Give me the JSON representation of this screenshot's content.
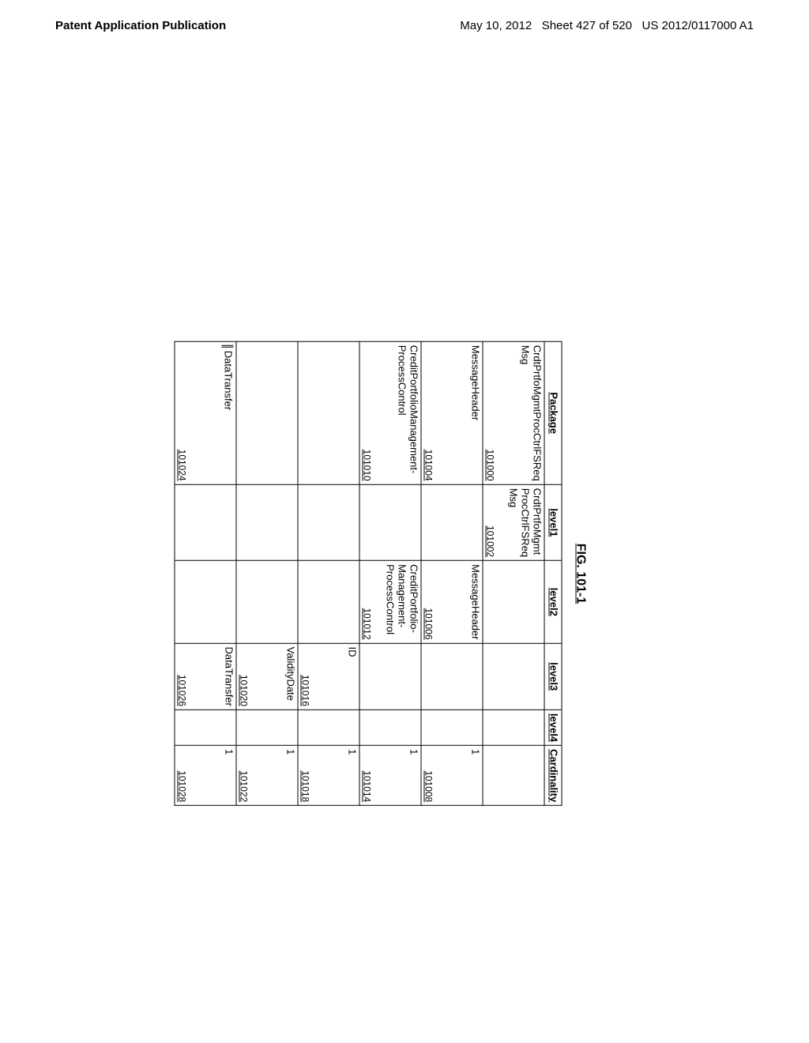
{
  "header": {
    "left": "Patent Application Publication",
    "right_date": "May 10, 2012",
    "right_sheet": "Sheet 427 of 520",
    "right_pub": "US 2012/0117000 A1"
  },
  "figure_title": "FIG. 101-1",
  "columns": [
    "Package",
    "level1",
    "level2",
    "level3",
    "level4",
    "Cardinality"
  ],
  "rows": [
    {
      "package": "CrdtPrtfoMgmtProcCtrlFSReq\nMsg",
      "package_ref": "101000",
      "level1": "CrdtPrtfoMgmt\nProcCtrlFSReq\nMsg",
      "level1_ref": "101002",
      "level2": "",
      "level2_ref": "",
      "level3": "",
      "level3_ref": "",
      "level4": "",
      "card": "",
      "card_ref": ""
    },
    {
      "package": "MessageHeader",
      "package_ref": "101004",
      "level1": "",
      "level1_ref": "",
      "level2": "MessageHeader",
      "level2_ref": "101006",
      "level3": "",
      "level3_ref": "",
      "level4": "",
      "card": "1",
      "card_ref": "101008"
    },
    {
      "package": "CreditPortfolioManagement-\nProcessControl",
      "package_ref": "101010",
      "level1": "",
      "level1_ref": "",
      "level2": "CreditPortfolio-\nManagement-\nProcessControl",
      "level2_ref": "101012",
      "level3": "",
      "level3_ref": "",
      "level4": "",
      "card": "1",
      "card_ref": "101014"
    },
    {
      "package": "",
      "package_ref": "",
      "level1": "",
      "level1_ref": "",
      "level2": "",
      "level2_ref": "",
      "level3": "ID",
      "level3_ref": "101016",
      "level4": "",
      "card": "1",
      "card_ref": "101018"
    },
    {
      "package": "",
      "package_ref": "",
      "level1": "",
      "level1_ref": "",
      "level2": "",
      "level2_ref": "",
      "level3": "ValidityDate",
      "level3_ref": "101020",
      "level4": "",
      "card": "1",
      "card_ref": "101022"
    },
    {
      "package": "DataTransfer",
      "package_ref": "101024",
      "package_indent": true,
      "level1": "",
      "level1_ref": "",
      "level2": "",
      "level2_ref": "",
      "level3": "DataTransfer",
      "level3_ref": "101026",
      "level4": "",
      "card": "1",
      "card_ref": "101028"
    }
  ]
}
